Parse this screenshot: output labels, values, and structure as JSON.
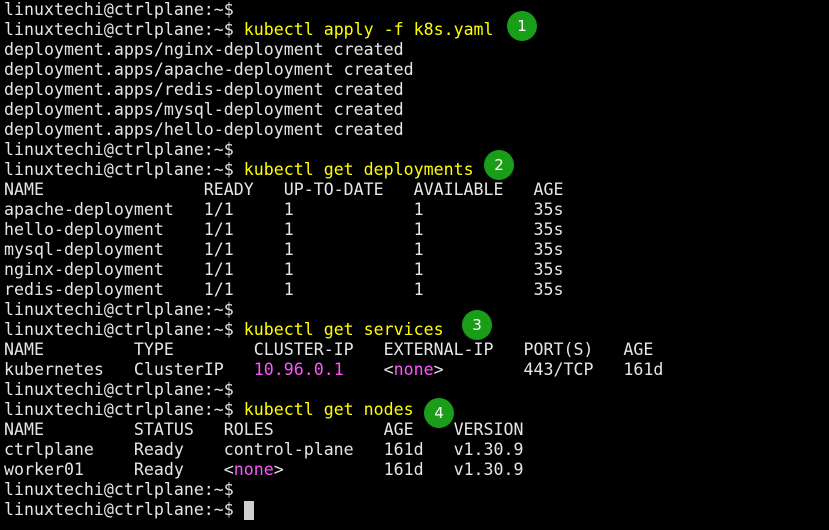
{
  "prompt": "linuxtechi@ctrlplane:~$ ",
  "colors": {
    "command": "#ffff00",
    "highlight": "#ff55ff",
    "badge": "#1a9e1a",
    "text": "#e5e5e5"
  },
  "commands": {
    "c1": "kubectl apply -f k8s.yaml",
    "c2": "kubectl get deployments",
    "c3": "kubectl get services",
    "c4": "kubectl get nodes"
  },
  "badges": {
    "b1": "1",
    "b2": "2",
    "b3": "3",
    "b4": "4"
  },
  "apply_output": [
    "deployment.apps/nginx-deployment created",
    "deployment.apps/apache-deployment created",
    "deployment.apps/redis-deployment created",
    "deployment.apps/mysql-deployment created",
    "deployment.apps/hello-deployment created"
  ],
  "deployments": {
    "header": "NAME                READY   UP-TO-DATE   AVAILABLE   AGE",
    "rows": [
      "apache-deployment   1/1     1            1           35s",
      "hello-deployment    1/1     1            1           35s",
      "mysql-deployment    1/1     1            1           35s",
      "nginx-deployment    1/1     1            1           35s",
      "redis-deployment    1/1     1            1           35s"
    ]
  },
  "services": {
    "header": "NAME         TYPE        CLUSTER-IP   EXTERNAL-IP   PORT(S)   AGE",
    "row": {
      "name": "kubernetes   ClusterIP   ",
      "cluster_ip": "10.96.0.1",
      "mid": "    <",
      "external": "none",
      "tail": ">        443/TCP   161d"
    }
  },
  "nodes": {
    "header": "NAME         STATUS   ROLES           AGE    VERSION",
    "row1": "ctrlplane    Ready    control-plane   161d   v1.30.9",
    "row2": {
      "pre": "worker01     Ready    <",
      "roles": "none",
      "tail": ">          161d   v1.30.9"
    }
  }
}
